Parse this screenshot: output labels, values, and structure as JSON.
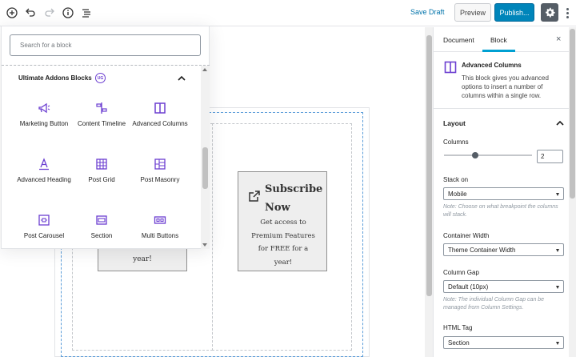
{
  "topbar": {
    "save_draft": "Save Draft",
    "preview": "Preview",
    "publish": "Publish..."
  },
  "inserter": {
    "search_placeholder": "Search for a block",
    "panel_title": "Ultimate Addons Blocks",
    "badge": "UG",
    "blocks": [
      {
        "label": "Marketing Button",
        "icon": "megaphone-icon"
      },
      {
        "label": "Content Timeline",
        "icon": "timeline-icon"
      },
      {
        "label": "Advanced Columns",
        "icon": "columns-icon"
      },
      {
        "label": "Advanced Heading",
        "icon": "heading-icon"
      },
      {
        "label": "Post Grid",
        "icon": "grid-icon"
      },
      {
        "label": "Post Masonry",
        "icon": "masonry-icon"
      },
      {
        "label": "Post Carousel",
        "icon": "carousel-icon"
      },
      {
        "label": "Section",
        "icon": "section-icon"
      },
      {
        "label": "Multi Buttons",
        "icon": "buttons-icon"
      }
    ],
    "accent_color": "#6c3fd1"
  },
  "canvas": {
    "left_card_text": "year!",
    "right_card": {
      "title_line1": "Subscribe",
      "title_line2": "Now",
      "desc": [
        "Get access to",
        "Premium Features",
        "for FREE for a",
        "year!"
      ]
    }
  },
  "sidebar": {
    "tab_document": "Document",
    "tab_block": "Block",
    "close": "×",
    "block_title": "Advanced Columns",
    "block_desc": "This block gives you advanced options to insert a number of columns within a single row.",
    "layout_title": "Layout",
    "columns_label": "Columns",
    "columns_value": "2",
    "stack_on_label": "Stack on",
    "stack_on_value": "Mobile",
    "stack_on_help": "Note: Choose on what breakpoint the columns will stack.",
    "container_width_label": "Container Width",
    "container_width_value": "Theme Container Width",
    "column_gap_label": "Column Gap",
    "column_gap_value": "Default (10px)",
    "column_gap_help": "Note: The individual Column Gap can be managed from Column Settings.",
    "html_tag_label": "HTML Tag",
    "html_tag_value": "Section"
  }
}
